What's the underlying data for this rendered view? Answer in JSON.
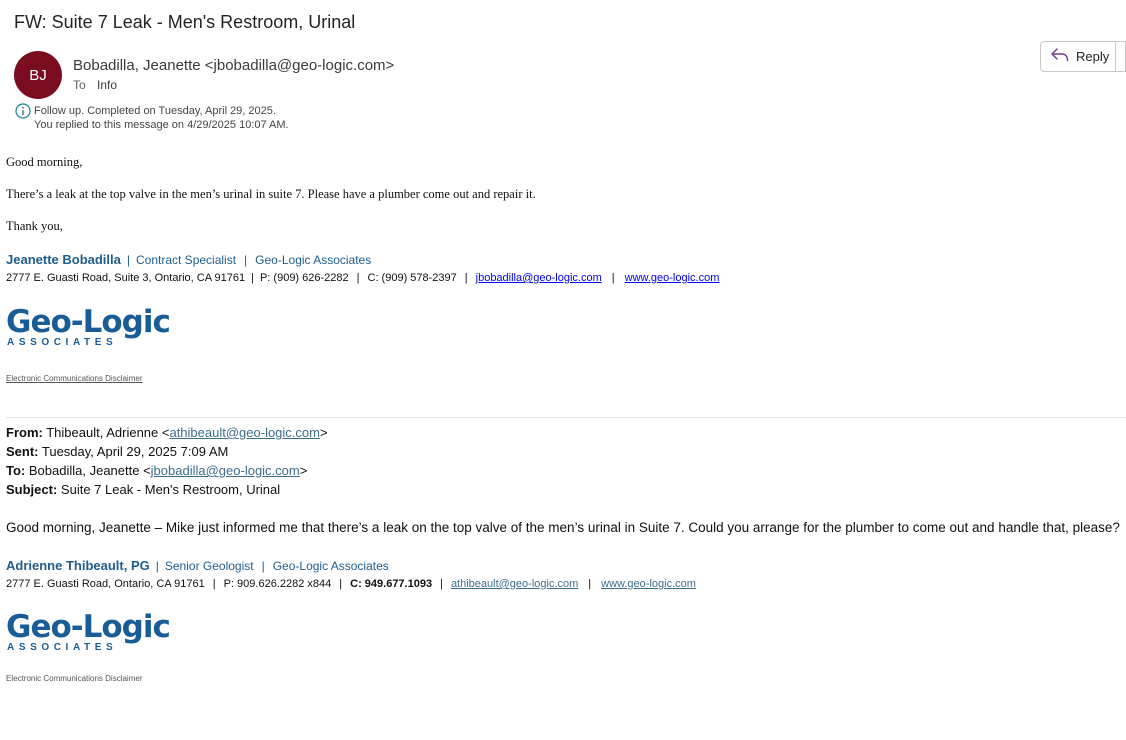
{
  "subject": "FW: Suite 7 Leak - Men's Restroom, Urinal",
  "sender": {
    "initials": "BJ",
    "name": "Bobadilla, Jeanette",
    "email": "<jbobadilla@geo-logic.com>",
    "avatar_color": "#7a0c1f"
  },
  "to": {
    "label": "To",
    "value": "Info"
  },
  "toolbar": {
    "reply_label": "Reply",
    "reply_icon": "reply-arrow-icon"
  },
  "followup": {
    "icon": "info-icon",
    "line1": "Follow up.  Completed on Tuesday, April 29, 2025.",
    "line2": "You replied to this message on 4/29/2025 10:07 AM."
  },
  "message": {
    "greeting": "Good morning,",
    "body": "There’s a leak at the top valve in the men’s urinal in suite 7. Please have a plumber come out and repair it.",
    "closing": "Thank you,"
  },
  "signature1": {
    "name": "Jeanette Bobadilla",
    "title": "Contract Specialist",
    "company": "Geo-Logic Associates",
    "address": "2777 E. Guasti Road, Suite 3, Ontario, CA 91761",
    "phone": "P: (909) 626-2282",
    "cell": "C: (909) 578-2397",
    "email": "jbobadilla@geo-logic.com",
    "website": "www.geo-logic.com",
    "logo_main": "Geo-Logic",
    "logo_sub": "ASSOCIATES",
    "disclaimer": "Electronic Communications Disclaimer"
  },
  "forwarded": {
    "from_label": "From:",
    "from_name": "Thibeault, Adrienne <",
    "from_email": "athibeault@geo-logic.com",
    "from_end": ">",
    "sent_label": "Sent:",
    "sent_value": "Tuesday, April 29, 2025 7:09 AM",
    "to_label": "To:",
    "to_name": "Bobadilla, Jeanette <",
    "to_email": "jbobadilla@geo-logic.com",
    "to_end": ">",
    "subject_label": "Subject:",
    "subject_value": "Suite 7 Leak - Men's Restroom, Urinal",
    "body": "Good morning, Jeanette – Mike just informed me that there’s a leak on the top valve of the men’s urinal in Suite 7. Could you arrange for the plumber to come out and handle that, please?"
  },
  "signature2": {
    "name": "Adrienne Thibeault, PG",
    "title": "Senior Geologist",
    "company": "Geo-Logic Associates",
    "address": "2777 E. Guasti Road, Ontario, CA 91761",
    "phone": "P: 909.626.2282 x844",
    "cell": "C: 949.677.1093",
    "email": "athibeault@geo-logic.com",
    "website": "www.geo-logic.com",
    "logo_main": "Geo-Logic",
    "logo_sub": "ASSOCIATES",
    "disclaimer": "Electronic Communications Disclaimer"
  }
}
